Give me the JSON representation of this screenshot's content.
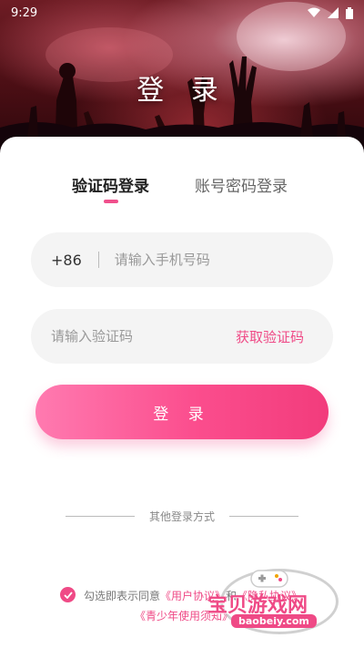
{
  "status_bar": {
    "time": "9:29"
  },
  "hero": {
    "title": "登 录"
  },
  "tabs": [
    {
      "label": "验证码登录",
      "active": true
    },
    {
      "label": "账号密码登录",
      "active": false
    }
  ],
  "phone": {
    "prefix": "+86",
    "placeholder": "请输入手机号码",
    "value": ""
  },
  "code": {
    "placeholder": "请输入验证码",
    "value": "",
    "get_code_label": "获取验证码"
  },
  "login_button": {
    "label": "登 录"
  },
  "other_login": {
    "label": "其他登录方式"
  },
  "agreement": {
    "checked": true,
    "prefix": "勾选即表示同意",
    "user_agreement": "《用户协议》",
    "and": "和",
    "privacy": "《隐私协议》",
    "minor_notice": "《青少年使用须知》"
  },
  "watermark": {
    "text": "宝贝游戏网",
    "url": "baobeiy.com"
  },
  "colors": {
    "accent": "#ef4a86",
    "button_start": "#ff7ab0",
    "button_end": "#f23c7c"
  }
}
